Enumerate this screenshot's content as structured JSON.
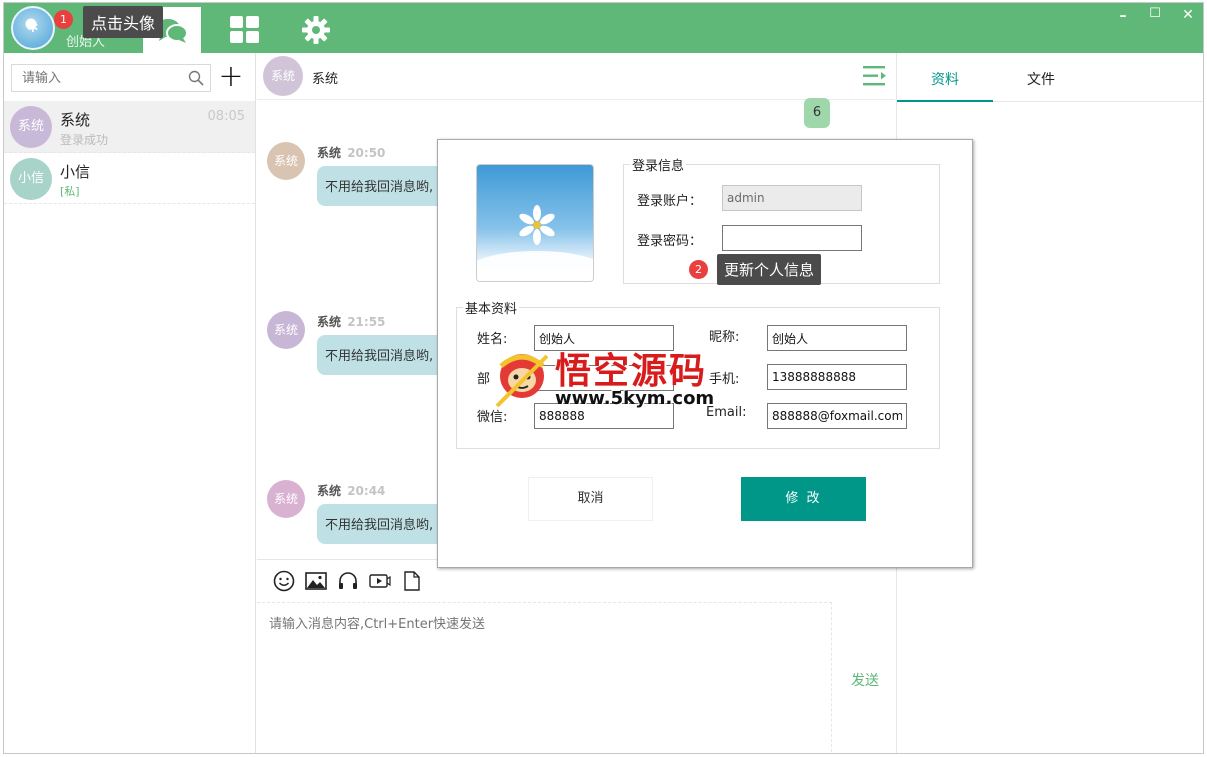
{
  "topbar": {
    "username": "创始人",
    "badge1": "1",
    "tooltip1": "点击头像",
    "window_controls": [
      "–",
      "☐",
      "✕"
    ]
  },
  "sidebar": {
    "search_placeholder": "请输入",
    "contacts": [
      {
        "avatar": "系统",
        "name": "系统",
        "sub": "登录成功",
        "time": "08:05",
        "avatar_color": "#c8b9d9"
      },
      {
        "avatar": "小信",
        "name": "小信",
        "sub": "[私]",
        "time": "",
        "avatar_color": "#a7d3c8"
      }
    ]
  },
  "chat": {
    "header_avatar": "系统",
    "header_title": "系统",
    "self_message": "6",
    "messages": [
      {
        "avatar": "系统",
        "sender": "系统",
        "time": "20:50",
        "text": "不用给我回消息哟,",
        "avatar_color": "#d9c4b1"
      },
      {
        "avatar": "系统",
        "sender": "系统",
        "time": "21:55",
        "text": "不用给我回消息哟,",
        "avatar_color": "#c7b6d6"
      },
      {
        "avatar": "系统",
        "sender": "系统",
        "time": "20:44",
        "text": "不用给我回消息哟,",
        "avatar_color": "#d9b2d1"
      }
    ],
    "input_placeholder": "请输入消息内容,Ctrl+Enter快速发送",
    "send_label": "发送",
    "tool_icons": [
      "emoji-icon",
      "image-icon",
      "headphones-icon",
      "video-icon",
      "file-icon"
    ]
  },
  "rightpanel": {
    "tabs": [
      "资料",
      "文件"
    ]
  },
  "modal": {
    "login_legend": "登录信息",
    "account_label": "登录账户：",
    "account_value": "admin",
    "password_label": "登录密码：",
    "password_value": "",
    "badge2": "2",
    "tooltip2": "更新个人信息",
    "basic_legend": "基本资料",
    "fields": {
      "name_label": "姓名:",
      "name_value": "创始人",
      "nick_label": "昵称:",
      "nick_value": "创始人",
      "dept_label": "部",
      "dept_value": "",
      "phone_label": "手机:",
      "phone_value": "13888888888",
      "wechat_label": "微信:",
      "wechat_value": "888888",
      "email_label": "Email:",
      "email_value": "888888@foxmail.com"
    },
    "cancel_label": "取消",
    "submit_label": "修 改"
  },
  "watermark": {
    "title": "悟空源码",
    "url": "www.5kym.com"
  },
  "colors": {
    "brand_green": "#5fb878",
    "teal": "#009688",
    "badge_red": "#e93f3f"
  }
}
